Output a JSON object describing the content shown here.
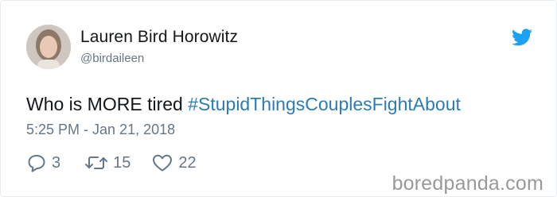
{
  "tweet": {
    "author_name": "Lauren Bird Horowitz",
    "author_handle": "@birdaileen",
    "text_plain": "Who is MORE tired",
    "hashtag": "#StupidThingsCouplesFightAbout",
    "timestamp": "5:25 PM - Jan 21, 2018",
    "reply_count": "3",
    "retweet_count": "15",
    "like_count": "22"
  },
  "colors": {
    "hashtag": "#2b7bb9",
    "twitter_bird": "#1da1f2",
    "muted_text": "#657786",
    "watermark": "#999999"
  },
  "icons": {
    "brand": "twitter-bird-icon",
    "reply": "reply-icon",
    "retweet": "retweet-icon",
    "like": "heart-icon"
  },
  "watermark": "boredpanda.com"
}
